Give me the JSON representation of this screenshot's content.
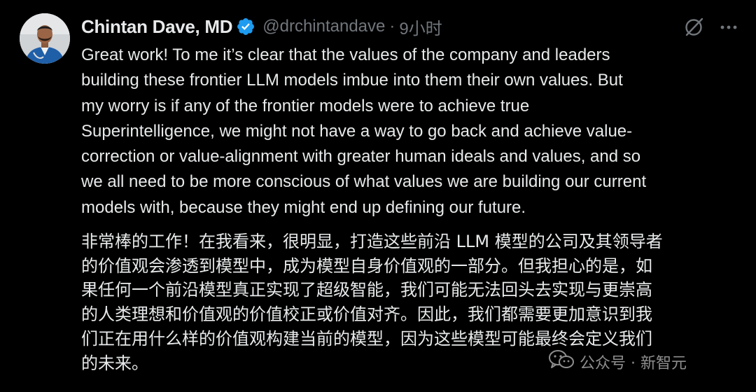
{
  "author": {
    "display_name": "Chintan Dave, MD",
    "handle": "@drchintandave",
    "separator": "·",
    "time": "9小时",
    "verified": true
  },
  "icons": {
    "verified": "verified-badge-icon",
    "grok": "grok-icon",
    "more": "more-options-icon",
    "watermark": "wechat-icon"
  },
  "tweet": {
    "text_en": "Great work! To me it’s clear that the values of the company and leaders\nbuilding these frontier LLM models imbue into them their own values. But\nmy worry is if any of the frontier models were to achieve true\nSuperintelligence, we might not have a way to go back and achieve value-\ncorrection or value-alignment with greater human ideals and values, and so\nwe all need to be more conscious of what values we are building our current\nmodels with, because they might end up defining our future.",
    "text_zh": "非常棒的工作！在我看来，很明显，打造这些前沿 LLM 模型的公司及其领导者\n的价值观会渗透到模型中，成为模型自身价值观的一部分。但我担心的是，如\n果任何一个前沿模型真正实现了超级智能，我们可能无法回头去实现与更崇高\n的人类理想和价值观的价值校正或价值对齐。因此，我们都需要更加意识到我\n们正在用什么样的价值观构建当前的模型，因为这些模型可能最终会定义我们\n的未来。"
  },
  "watermark": {
    "text": "公众号 · 新智元"
  },
  "colors": {
    "background": "#000000",
    "text_primary": "#e7e9ea",
    "text_secondary": "#71767b",
    "verified_blue": "#1d9bf0"
  }
}
